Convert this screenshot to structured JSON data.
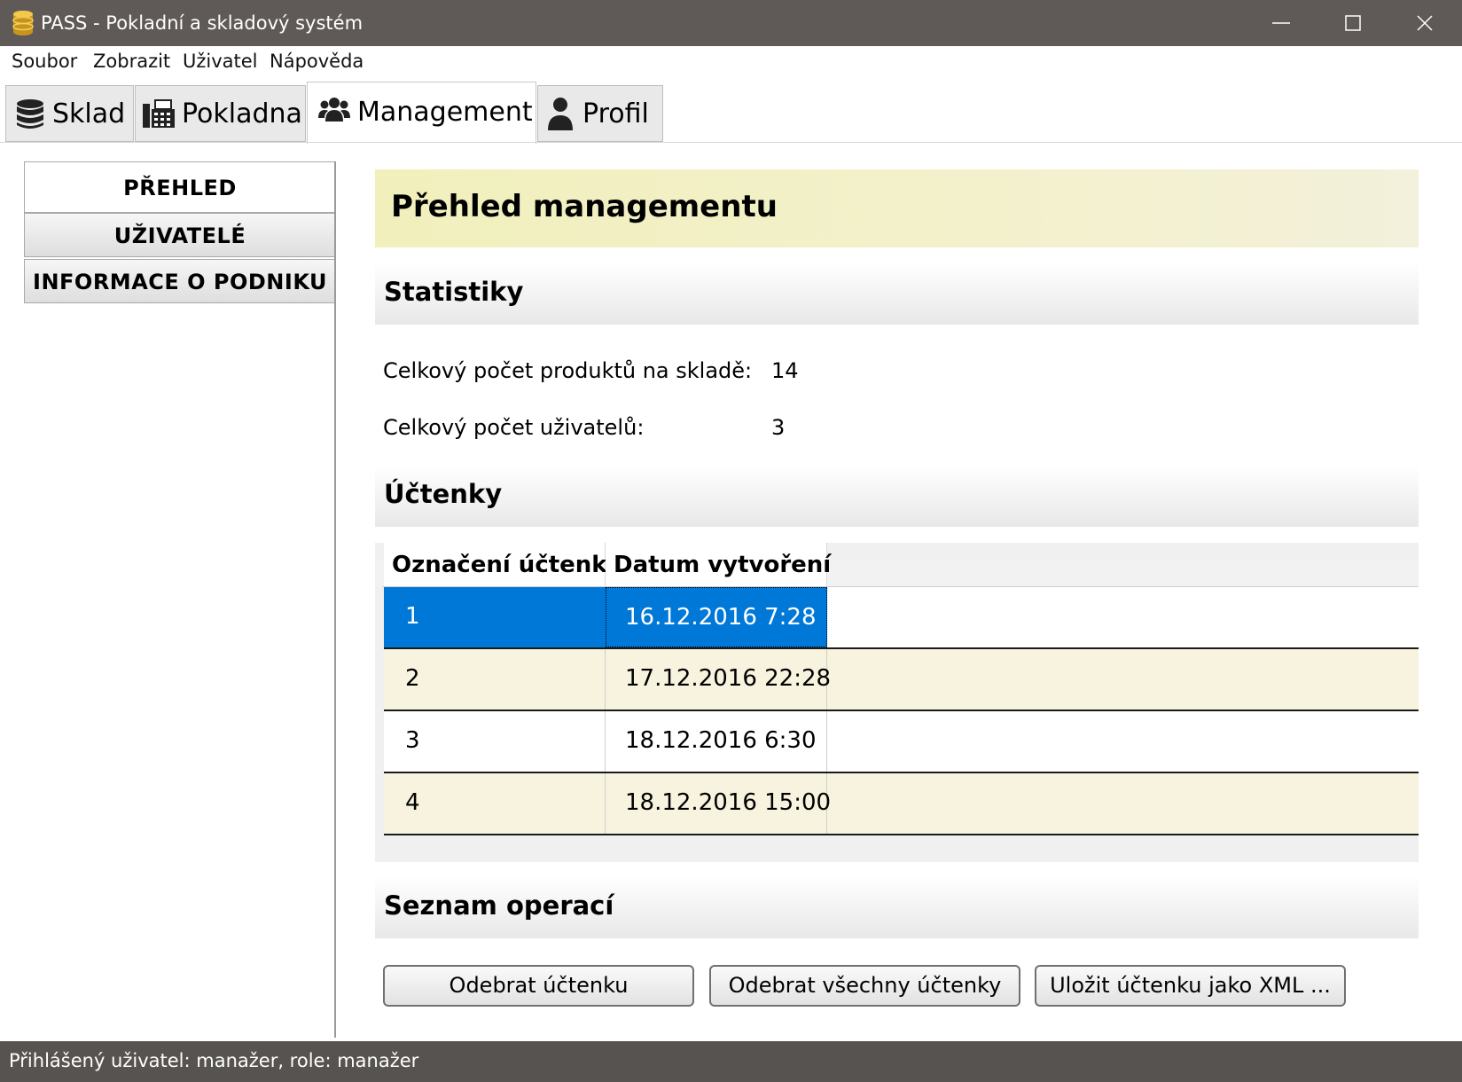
{
  "window": {
    "title": "PASS - Pokladní a skladový systém"
  },
  "menu": [
    "Soubor",
    "Zobrazit",
    "Uživatel",
    "Nápověda"
  ],
  "tabs": [
    {
      "label": "Sklad",
      "icon": "database-icon"
    },
    {
      "label": "Pokladna",
      "icon": "fax-icon"
    },
    {
      "label": "Management",
      "icon": "users-icon",
      "active": true
    },
    {
      "label": "Profil",
      "icon": "user-icon"
    }
  ],
  "side_nav": [
    {
      "label": "PŘEHLED",
      "active": true
    },
    {
      "label": "UŽIVATELÉ"
    },
    {
      "label": "INFORMACE O PODNIKU"
    }
  ],
  "main": {
    "title": "Přehled managementu",
    "stats_header": "Statistiky",
    "stats": [
      {
        "label": "Celkový počet produktů na skladě:",
        "value": "14"
      },
      {
        "label": "Celkový počet uživatelů:",
        "value": "3"
      }
    ],
    "receipts_header": "Účtenky",
    "receipts": {
      "columns": [
        "Označení účtenky",
        "Datum vytvoření"
      ],
      "rows": [
        [
          "1",
          "16.12.2016 7:28"
        ],
        [
          "2",
          "17.12.2016 22:28"
        ],
        [
          "3",
          "18.12.2016 6:30"
        ],
        [
          "4",
          "18.12.2016 15:00"
        ]
      ],
      "selected_row": 0
    },
    "operations_header": "Seznam operací",
    "buttons": [
      "Odebrat účtenku",
      "Odebrat všechny účtenky",
      "Uložit účtenku jako XML ..."
    ]
  },
  "status": "Přihlášený uživatel: manažer, role: manažer",
  "colors": {
    "titlebar": "#5f5a57",
    "statusbar": "#575350",
    "header_yellow": "#f1f0bc",
    "row_alt": "#f7f3de",
    "selection": "#0078d7"
  }
}
